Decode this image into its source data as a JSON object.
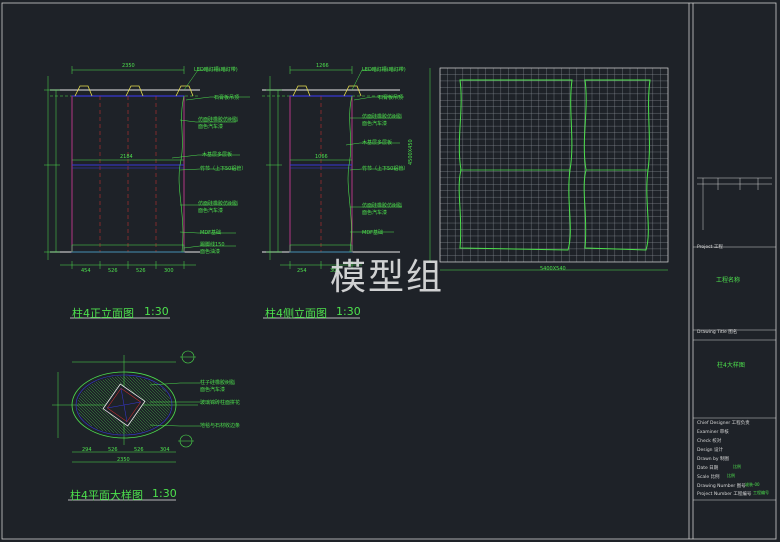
{
  "views": {
    "front": {
      "title": "柱4正立面图",
      "scale": "1:30"
    },
    "side": {
      "title": "柱4侧立面图",
      "scale": "1:30"
    },
    "plan": {
      "title": "柱4平面大样图",
      "scale": "1:30"
    }
  },
  "front_annotations": [
    "LED暗灯槽(暗灯带)",
    "石膏板吊顶",
    "仿面硅橡胶仿树脂",
    "面色汽车漆",
    "木基层多层板",
    "竹节（上下50铝管）",
    "仿面硅橡胶仿树脂",
    "面色汽车漆",
    "MDF基础",
    "踢脚线150",
    "面色油漆"
  ],
  "side_annotations": [
    "LED暗灯槽(暗灯带)",
    "石膏板吊顶",
    "仿面硅橡胶仿树脂",
    "面色汽车漆",
    "木基层多层板",
    "竹节（上下50铝管）",
    "仿面硅橡胶仿树脂",
    "面色汽车漆",
    "MDF基础"
  ],
  "plan_annotations": [
    "柱子硅橡胶树脂",
    "面色汽车漆",
    "玻璃锦砖柱面拼花",
    "地毯与石材收边条"
  ],
  "dims": {
    "front_top": "2350",
    "front_mid": "2184",
    "front_bottom": [
      "454",
      "526",
      "526",
      "300"
    ],
    "side_top": "1266",
    "side_mid": "1066",
    "side_bottom": [
      "254",
      "300"
    ],
    "plan_bottom": [
      "294",
      "526",
      "526",
      "304"
    ],
    "plan_total": "2350",
    "grid_bottom": "5400X540",
    "grid_side": "4500X450"
  },
  "title_block": {
    "project_label": "Project 工程",
    "project_name": "工程名称",
    "drawing_title_label": "Drawing Title 图名",
    "drawing_title": "柱4大样图",
    "rows": [
      {
        "label": "Chief Designer 工程负责",
        "value": ""
      },
      {
        "label": "Examiner 审核",
        "value": ""
      },
      {
        "label": "Check 校对",
        "value": ""
      },
      {
        "label": "Design 设计",
        "value": ""
      },
      {
        "label": "Drawn by 制图",
        "value": ""
      },
      {
        "label": "Date 日期",
        "value": "比例"
      },
      {
        "label": "Scale 比例",
        "value": "比例"
      },
      {
        "label": "Drawing Number 图号",
        "value": "竣装-00"
      },
      {
        "label": "Project Number 工程编号",
        "value": "工程编号"
      }
    ]
  },
  "watermark": "模型组",
  "colors": {
    "background": "#1e2228",
    "green": "#4de04d",
    "yellow": "#e8e050",
    "red": "#e03030",
    "blue": "#3838d8",
    "white": "#e8e8e8"
  }
}
